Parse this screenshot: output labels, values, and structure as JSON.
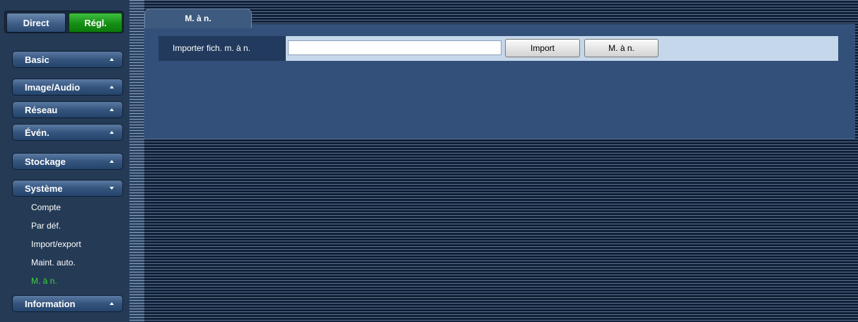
{
  "mode_tabs": {
    "direct": "Direct",
    "settings": "Régl.",
    "active": "settings"
  },
  "sidebar": {
    "menus": [
      {
        "label": "Basic",
        "expanded": false
      },
      {
        "label": "Image/Audio",
        "expanded": false
      },
      {
        "label": "Réseau",
        "expanded": false
      },
      {
        "label": "Évén.",
        "expanded": false
      },
      {
        "label": "Stockage",
        "expanded": false
      },
      {
        "label": "Système",
        "expanded": true
      },
      {
        "label": "Information",
        "expanded": false
      }
    ],
    "system_items": [
      {
        "label": "Compte",
        "active": false
      },
      {
        "label": "Par déf.",
        "active": false
      },
      {
        "label": "Import/export",
        "active": false
      },
      {
        "label": "Maint. auto.",
        "active": false
      },
      {
        "label": "M. à n.",
        "active": true
      }
    ]
  },
  "main": {
    "tab_label": "M. à n.",
    "form": {
      "label": "Importer fich. m. à n.",
      "file_value": "",
      "import_button": "Import",
      "update_button": "M. à n."
    }
  },
  "colors": {
    "accent_active": "#158f15",
    "active_item_text": "#3fd43f",
    "panel": "#33507a"
  }
}
